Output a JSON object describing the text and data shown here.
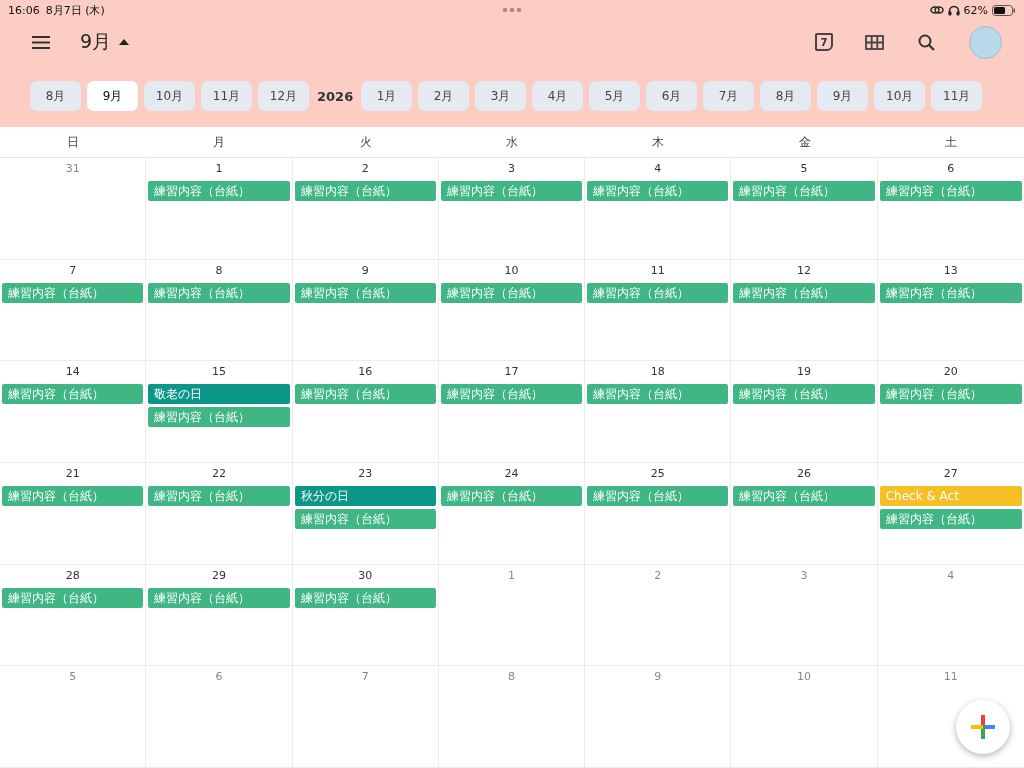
{
  "status_bar": {
    "time": "16:06",
    "date": "8月7日 (木)",
    "battery": "62%"
  },
  "toolbar": {
    "month": "9月",
    "today": "7"
  },
  "month_strip": [
    {
      "kind": "month",
      "label": "8月",
      "selected": false
    },
    {
      "kind": "month",
      "label": "9月",
      "selected": true
    },
    {
      "kind": "month",
      "label": "10月",
      "selected": false
    },
    {
      "kind": "month",
      "label": "11月",
      "selected": false
    },
    {
      "kind": "month",
      "label": "12月",
      "selected": false
    },
    {
      "kind": "year",
      "label": "2026",
      "selected": false
    },
    {
      "kind": "month",
      "label": "1月",
      "selected": false
    },
    {
      "kind": "month",
      "label": "2月",
      "selected": false
    },
    {
      "kind": "month",
      "label": "3月",
      "selected": false
    },
    {
      "kind": "month",
      "label": "4月",
      "selected": false
    },
    {
      "kind": "month",
      "label": "5月",
      "selected": false
    },
    {
      "kind": "month",
      "label": "6月",
      "selected": false
    },
    {
      "kind": "month",
      "label": "7月",
      "selected": false
    },
    {
      "kind": "month",
      "label": "8月",
      "selected": false
    },
    {
      "kind": "month",
      "label": "9月",
      "selected": false
    },
    {
      "kind": "month",
      "label": "10月",
      "selected": false
    },
    {
      "kind": "month",
      "label": "11月",
      "selected": false
    }
  ],
  "weekdays": [
    "日",
    "月",
    "火",
    "水",
    "木",
    "金",
    "土"
  ],
  "weeks": [
    [
      {
        "date": "31",
        "muted": true
      },
      {
        "date": "1",
        "muted": false,
        "events": [
          {
            "title": "練習内容（台紙）",
            "color": "#3fb684"
          }
        ]
      },
      {
        "date": "2",
        "muted": false,
        "events": [
          {
            "title": "練習内容（台紙）",
            "color": "#3fb684"
          }
        ]
      },
      {
        "date": "3",
        "muted": false,
        "events": [
          {
            "title": "練習内容（台紙）",
            "color": "#3fb684"
          }
        ]
      },
      {
        "date": "4",
        "muted": false,
        "events": [
          {
            "title": "練習内容（台紙）",
            "color": "#3fb684"
          }
        ]
      },
      {
        "date": "5",
        "muted": false,
        "events": [
          {
            "title": "練習内容（台紙）",
            "color": "#3fb684"
          }
        ]
      },
      {
        "date": "6",
        "muted": false,
        "events": [
          {
            "title": "練習内容（台紙）",
            "color": "#3fb684"
          }
        ]
      }
    ],
    [
      {
        "date": "7",
        "muted": false,
        "events": [
          {
            "title": "練習内容（台紙）",
            "color": "#3fb684"
          }
        ]
      },
      {
        "date": "8",
        "muted": false,
        "events": [
          {
            "title": "練習内容（台紙）",
            "color": "#3fb684"
          }
        ]
      },
      {
        "date": "9",
        "muted": false,
        "events": [
          {
            "title": "練習内容（台紙）",
            "color": "#3fb684"
          }
        ]
      },
      {
        "date": "10",
        "muted": false,
        "events": [
          {
            "title": "練習内容（台紙）",
            "color": "#3fb684"
          }
        ]
      },
      {
        "date": "11",
        "muted": false,
        "events": [
          {
            "title": "練習内容（台紙）",
            "color": "#3fb684"
          }
        ]
      },
      {
        "date": "12",
        "muted": false,
        "events": [
          {
            "title": "練習内容（台紙）",
            "color": "#3fb684"
          }
        ]
      },
      {
        "date": "13",
        "muted": false,
        "events": [
          {
            "title": "練習内容（台紙）",
            "color": "#3fb684"
          }
        ]
      }
    ],
    [
      {
        "date": "14",
        "muted": false,
        "events": [
          {
            "title": "練習内容（台紙）",
            "color": "#3fb684"
          }
        ]
      },
      {
        "date": "15",
        "muted": false,
        "events": [
          {
            "title": "敬老の日",
            "color": "#0b9688"
          },
          {
            "title": "練習内容（台紙）",
            "color": "#3fb684"
          }
        ]
      },
      {
        "date": "16",
        "muted": false,
        "events": [
          {
            "title": "練習内容（台紙）",
            "color": "#3fb684"
          }
        ]
      },
      {
        "date": "17",
        "muted": false,
        "events": [
          {
            "title": "練習内容（台紙）",
            "color": "#3fb684"
          }
        ]
      },
      {
        "date": "18",
        "muted": false,
        "events": [
          {
            "title": "練習内容（台紙）",
            "color": "#3fb684"
          }
        ]
      },
      {
        "date": "19",
        "muted": false,
        "events": [
          {
            "title": "練習内容（台紙）",
            "color": "#3fb684"
          }
        ]
      },
      {
        "date": "20",
        "muted": false,
        "events": [
          {
            "title": "練習内容（台紙）",
            "color": "#3fb684"
          }
        ]
      }
    ],
    [
      {
        "date": "21",
        "muted": false,
        "events": [
          {
            "title": "練習内容（台紙）",
            "color": "#3fb684"
          }
        ]
      },
      {
        "date": "22",
        "muted": false,
        "events": [
          {
            "title": "練習内容（台紙）",
            "color": "#3fb684"
          }
        ]
      },
      {
        "date": "23",
        "muted": false,
        "events": [
          {
            "title": "秋分の日",
            "color": "#0b9688"
          },
          {
            "title": "練習内容（台紙）",
            "color": "#3fb684"
          }
        ]
      },
      {
        "date": "24",
        "muted": false,
        "events": [
          {
            "title": "練習内容（台紙）",
            "color": "#3fb684"
          }
        ]
      },
      {
        "date": "25",
        "muted": false,
        "events": [
          {
            "title": "練習内容（台紙）",
            "color": "#3fb684"
          }
        ]
      },
      {
        "date": "26",
        "muted": false,
        "events": [
          {
            "title": "練習内容（台紙）",
            "color": "#3fb684"
          }
        ]
      },
      {
        "date": "27",
        "muted": false,
        "events": [
          {
            "title": "Check & Act",
            "color": "#f6bf26"
          },
          {
            "title": "練習内容（台紙）",
            "color": "#3fb684"
          }
        ]
      }
    ],
    [
      {
        "date": "28",
        "muted": false,
        "events": [
          {
            "title": "練習内容（台紙）",
            "color": "#3fb684"
          }
        ]
      },
      {
        "date": "29",
        "muted": false,
        "events": [
          {
            "title": "練習内容（台紙）",
            "color": "#3fb684"
          }
        ]
      },
      {
        "date": "30",
        "muted": false,
        "events": [
          {
            "title": "練習内容（台紙）",
            "color": "#3fb684"
          }
        ]
      },
      {
        "date": "1",
        "muted": true
      },
      {
        "date": "2",
        "muted": true
      },
      {
        "date": "3",
        "muted": true
      },
      {
        "date": "4",
        "muted": true
      }
    ],
    [
      {
        "date": "5",
        "muted": true
      },
      {
        "date": "6",
        "muted": true
      },
      {
        "date": "7",
        "muted": true
      },
      {
        "date": "8",
        "muted": true
      },
      {
        "date": "9",
        "muted": true
      },
      {
        "date": "10",
        "muted": true
      },
      {
        "date": "11",
        "muted": true
      }
    ]
  ]
}
